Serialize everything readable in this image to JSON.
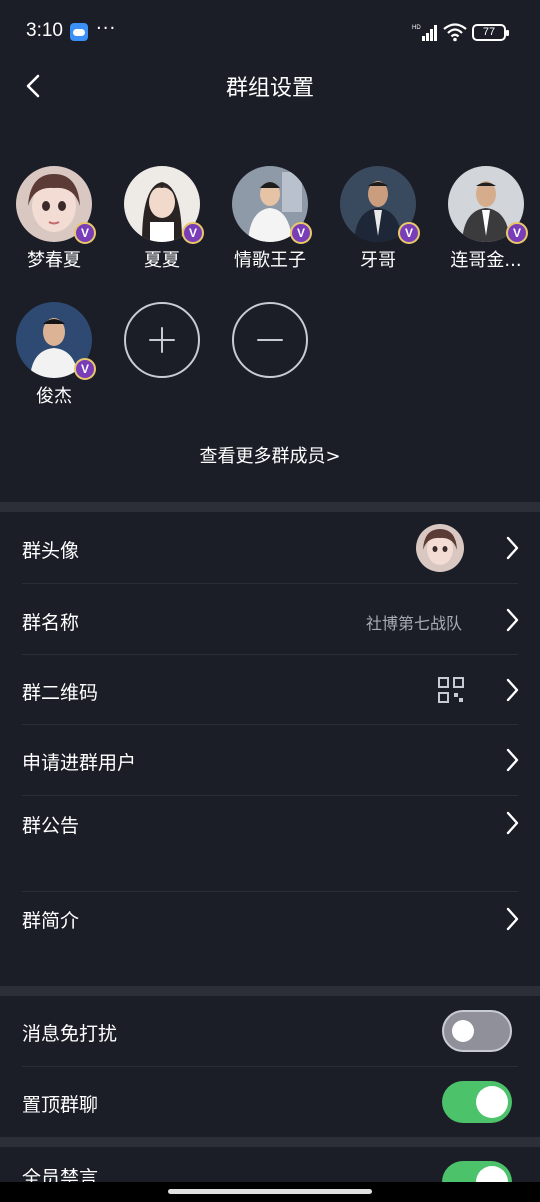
{
  "status_bar": {
    "time": "3:10",
    "dots": "···",
    "battery": "77"
  },
  "header": {
    "title": "群组设置"
  },
  "members": [
    {
      "name": "梦春夏",
      "badge": "V",
      "color": "#d9c7c2"
    },
    {
      "name": "夏夏",
      "badge": "V",
      "color": "#e7e4e0"
    },
    {
      "name": "情歌王子",
      "badge": "V",
      "color": "#8e9aa8"
    },
    {
      "name": "牙哥",
      "badge": "V",
      "color": "#2f3a4a"
    },
    {
      "name": "连哥金...",
      "badge": "V",
      "color": "#c9ccd1"
    },
    {
      "name": "俊杰",
      "badge": "V",
      "color": "#2e4a72"
    }
  ],
  "more_members": "查看更多群成员>",
  "settings": {
    "avatar_label": "群头像",
    "name_label": "群名称",
    "name_value": "社博第七战队",
    "qrcode_label": "群二维码",
    "apply_label": "申请进群用户",
    "notice_label": "群公告",
    "intro_label": "群简介"
  },
  "toggles": {
    "mute_label": "消息免打扰",
    "mute_on": false,
    "pin_label": "置顶群聊",
    "pin_on": true,
    "all_mute_label": "全员禁言",
    "all_mute_on": true
  },
  "colors": {
    "background": "#1b1d27",
    "divider": "#2c2e38",
    "toggle_on": "#4cc36a",
    "toggle_off": "#8f9099",
    "badge": "#7a3db8"
  }
}
